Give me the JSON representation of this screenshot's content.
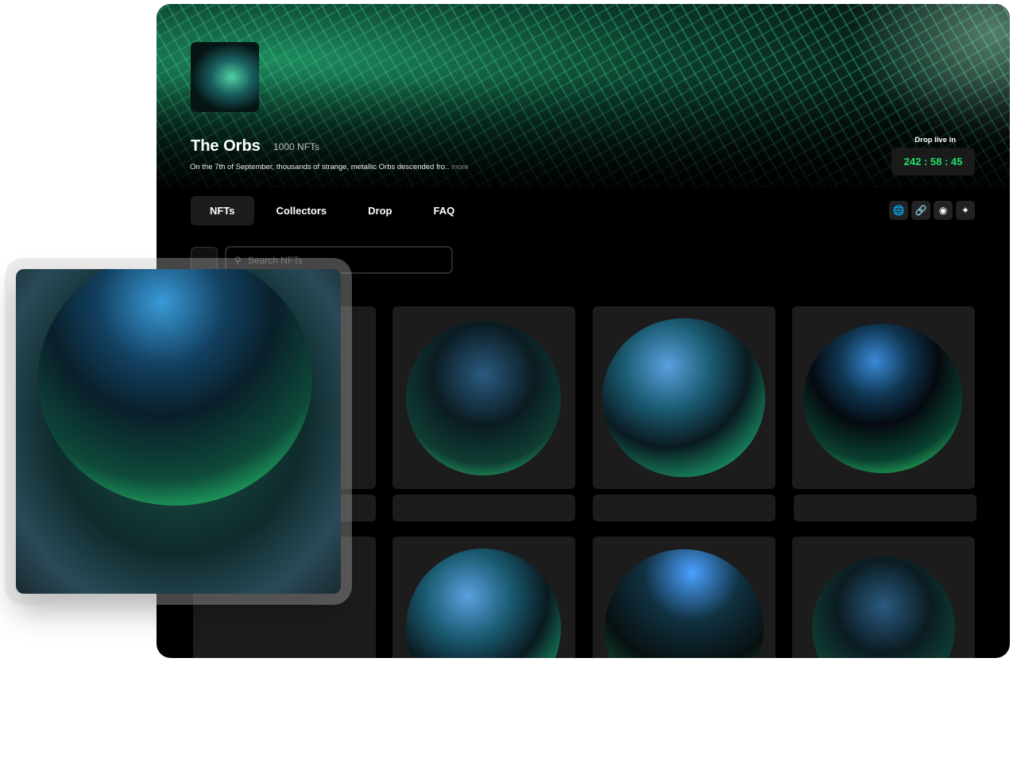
{
  "collection": {
    "title": "The Orbs",
    "count": "1000 NFTs",
    "description": "On the 7th of September, thousands of strange, metallic Orbs descended fro..",
    "more_label": "more"
  },
  "drop": {
    "label": "Drop live in",
    "timer": "242 : 58 : 45",
    "accent": "#22e06a"
  },
  "tabs": [
    {
      "label": "NFTs",
      "active": true
    },
    {
      "label": "Collectors"
    },
    {
      "label": "Drop"
    },
    {
      "label": "FAQ"
    }
  ],
  "socials": [
    "globe-icon",
    "link-icon",
    "discord-icon",
    "twitter-icon"
  ],
  "search": {
    "placeholder": "Search NFTs"
  }
}
